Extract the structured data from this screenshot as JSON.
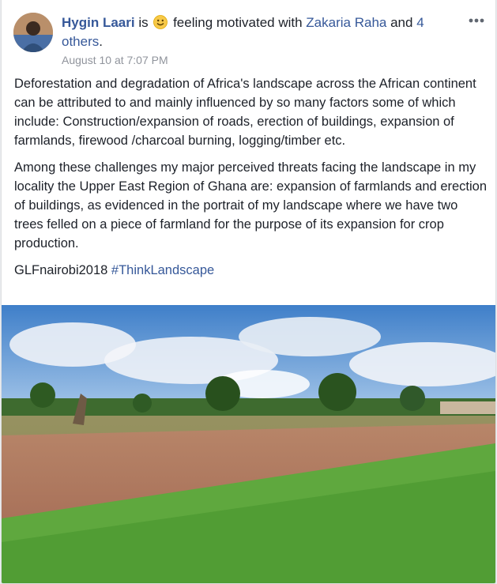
{
  "post": {
    "author_name": "Hygin Laari",
    "status_is": "is",
    "feeling_text": "feeling motivated with",
    "tagged_person": "Zakaria Raha",
    "and_text": "and",
    "others_link": "4 others",
    "period": ".",
    "timestamp": "August 10 at 7:07 PM",
    "paragraphs": [
      "Deforestation and degradation of Africa's landscape across the African continent can be attributed to and mainly influenced by so many factors some of which include: Construction/expansion of roads, erection of buildings, expansion of farmlands, firewood /charcoal burning, logging/timber etc.",
      "Among these challenges my major perceived threats facing the landscape in my locality the Upper East Region of Ghana are: expansion of farmlands and erection of buildings, as evidenced in the portrait of my landscape where we have two trees felled on a piece of farmland for the purpose of its expansion for crop production."
    ],
    "tag_plain": "GLFnairobi2018",
    "hashtag": "#ThinkLandscape"
  },
  "icons": {
    "feeling": "smiley-emoji-icon",
    "more": "more-options-icon"
  },
  "colors": {
    "link": "#365899",
    "text": "#1d2129",
    "muted": "#90949c"
  }
}
